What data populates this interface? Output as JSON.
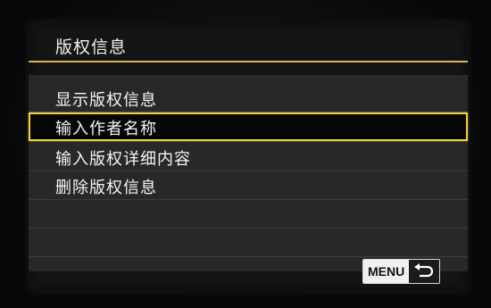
{
  "header": {
    "title": "版权信息"
  },
  "menu": {
    "items": [
      {
        "label": "显示版权信息",
        "selected": false
      },
      {
        "label": "输入作者名称",
        "selected": true
      },
      {
        "label": "输入版权详细内容",
        "selected": false
      },
      {
        "label": "删除版权信息",
        "selected": false
      }
    ]
  },
  "footer": {
    "menu_label": "MENU",
    "back_icon": "return-arrow-icon"
  },
  "colors": {
    "accent": "#f0cf3a",
    "title_rule": "#d9b64a",
    "background": "#262829"
  }
}
